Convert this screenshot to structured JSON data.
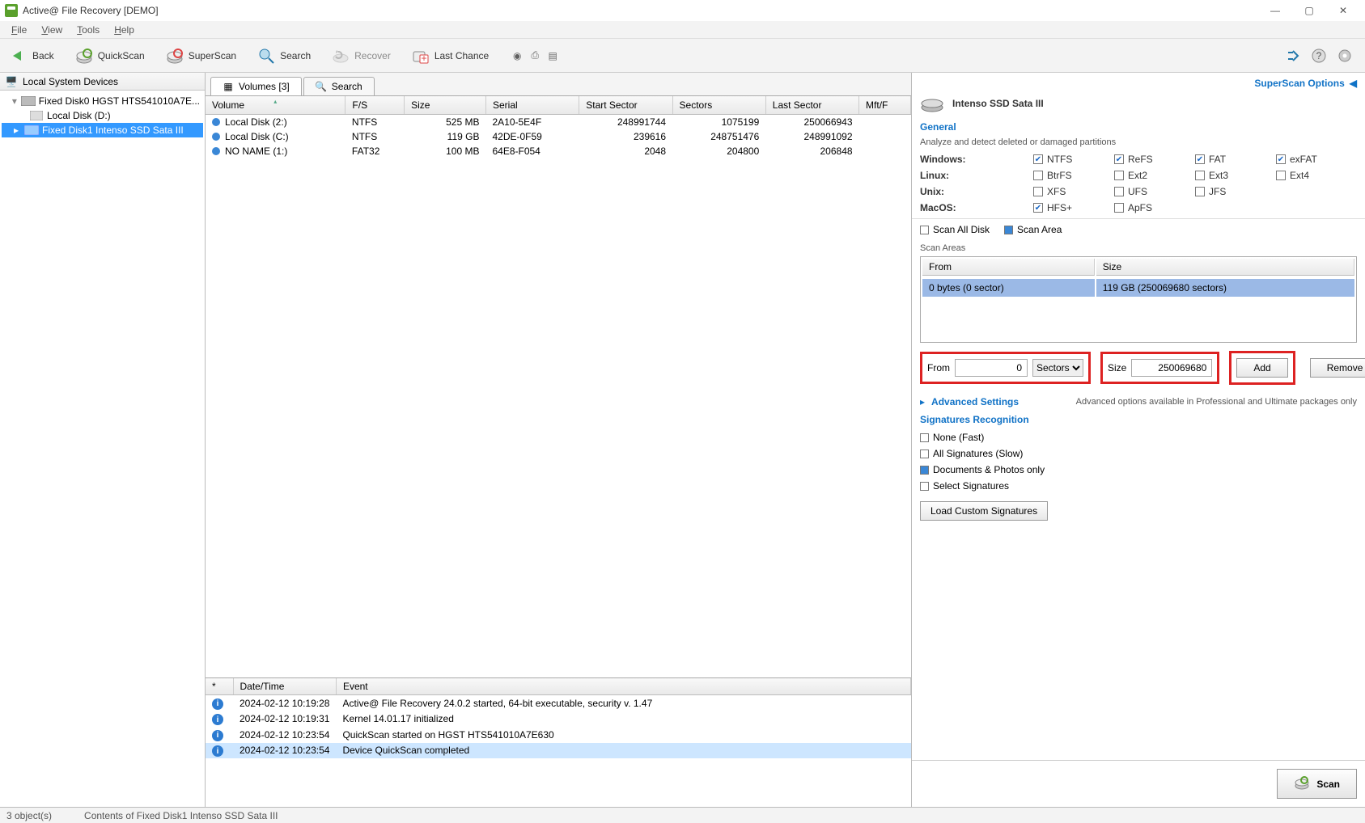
{
  "window": {
    "title": "Active@ File Recovery [DEMO]"
  },
  "menu": {
    "file": "File",
    "view": "View",
    "tools": "Tools",
    "help": "Help"
  },
  "toolbar": {
    "back": "Back",
    "quickscan": "QuickScan",
    "superscan": "SuperScan",
    "search": "Search",
    "recover": "Recover",
    "lastchance": "Last Chance"
  },
  "left": {
    "header": "Local System Devices",
    "disk0": "Fixed Disk0 HGST HTS541010A7E...",
    "localD": "Local Disk (D:)",
    "disk1": "Fixed Disk1 Intenso SSD Sata III"
  },
  "tabs": {
    "volumes": "Volumes [3]",
    "search": "Search"
  },
  "vol_cols": {
    "volume": "Volume",
    "fs": "F/S",
    "size": "Size",
    "serial": "Serial",
    "start": "Start Sector",
    "sectors": "Sectors",
    "last": "Last Sector",
    "mft": "Mft/F"
  },
  "volumes": [
    {
      "name": "Local Disk (2:)",
      "fs": "NTFS",
      "size": "525 MB",
      "serial": "2A10-5E4F",
      "start": "248991744",
      "sectors": "1075199",
      "last": "250066943"
    },
    {
      "name": "Local Disk (C:)",
      "fs": "NTFS",
      "size": "119 GB",
      "serial": "42DE-0F59",
      "start": "239616",
      "sectors": "248751476",
      "last": "248991092"
    },
    {
      "name": "NO NAME (1:)",
      "fs": "FAT32",
      "size": "100 MB",
      "serial": "64E8-F054",
      "start": "2048",
      "sectors": "204800",
      "last": "206848"
    }
  ],
  "log_cols": {
    "star": "*",
    "dt": "Date/Time",
    "event": "Event"
  },
  "log": [
    {
      "dt": "2024-02-12 10:19:28",
      "ev": "Active@ File Recovery 24.0.2 started, 64-bit executable, security v. 1.47"
    },
    {
      "dt": "2024-02-12 10:19:31",
      "ev": "Kernel 14.01.17 initialized"
    },
    {
      "dt": "2024-02-12 10:23:54",
      "ev": "QuickScan started on HGST HTS541010A7E630"
    },
    {
      "dt": "2024-02-12 10:23:54",
      "ev": "Device QuickScan completed"
    }
  ],
  "right": {
    "title": "SuperScan Options",
    "disk": "Intenso SSD Sata III",
    "general": "General",
    "general_sub": "Analyze and detect deleted or damaged partitions",
    "os": {
      "windows": "Windows:",
      "linux": "Linux:",
      "unix": "Unix:",
      "macos": "MacOS:"
    },
    "fs": {
      "ntfs": "NTFS",
      "refs": "ReFS",
      "fat": "FAT",
      "exfat": "exFAT",
      "btrfs": "BtrFS",
      "ext2": "Ext2",
      "ext3": "Ext3",
      "ext4": "Ext4",
      "xfs": "XFS",
      "ufs": "UFS",
      "jfs": "JFS",
      "hfsp": "HFS+",
      "apfs": "ApFS"
    },
    "scan_all": "Scan All Disk",
    "scan_area": "Scan Area",
    "areas_label": "Scan Areas",
    "area_cols": {
      "from": "From",
      "size": "Size"
    },
    "area_row": {
      "from": "0 bytes (0 sector)",
      "size": "119 GB (250069680 sectors)"
    },
    "from_label": "From",
    "from_value": "0",
    "unit": "Sectors",
    "unit_opts": [
      "Sectors"
    ],
    "size_label": "Size",
    "size_value": "250069680",
    "add": "Add",
    "remove": "Remove",
    "adv": "Advanced Settings",
    "adv_note": "Advanced options available in Professional and Ultimate packages only",
    "sig": "Signatures Recognition",
    "sig_none": "None (Fast)",
    "sig_all": "All Signatures (Slow)",
    "sig_docs": "Documents & Photos only",
    "sig_sel": "Select Signatures",
    "load": "Load Custom Signatures",
    "scan": "Scan"
  },
  "status": {
    "left": "3 object(s)",
    "right": "Contents of Fixed Disk1 Intenso SSD Sata III"
  }
}
